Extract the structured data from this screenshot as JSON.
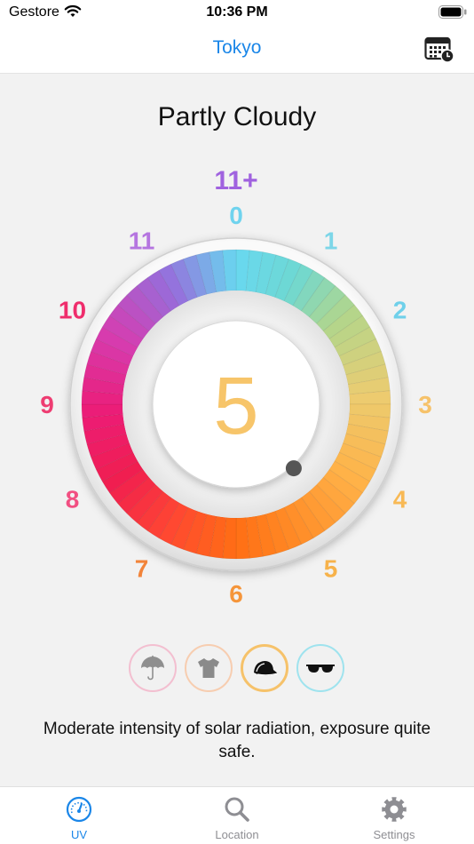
{
  "status_bar": {
    "carrier": "Gestore",
    "time": "10:36 PM"
  },
  "nav": {
    "title": "Tokyo",
    "calendar_icon": "calendar-clock-icon"
  },
  "weather": {
    "condition": "Partly Cloudy"
  },
  "uv": {
    "value": "5",
    "level": 5,
    "scale_labels": [
      "0",
      "1",
      "2",
      "3",
      "4",
      "5",
      "6",
      "7",
      "8",
      "9",
      "10",
      "11",
      "11+"
    ],
    "label_colors": [
      "#6fd3ee",
      "#7dd6e8",
      "#6fd0ea",
      "#f6c26a",
      "#f8b955",
      "#f7b24a",
      "#f5953a",
      "#f2843a",
      "#f24f82",
      "#ee3d72",
      "#ef2d6c",
      "#b575e0",
      "#a062df"
    ],
    "number_color": "#f7c56a"
  },
  "protection_icons": [
    {
      "icon": "umbrella-icon",
      "color": "#f3bfd0"
    },
    {
      "icon": "tshirt-icon",
      "color": "#f7cdb0"
    },
    {
      "icon": "cap-icon",
      "color": "#f6c26a"
    },
    {
      "icon": "sunglasses-icon",
      "color": "#9fe3ee"
    }
  ],
  "description": "Moderate intensity of solar radiation, exposure quite safe.",
  "tabs": [
    {
      "label": "UV",
      "icon": "gauge-icon",
      "active": true
    },
    {
      "label": "Location",
      "icon": "search-icon",
      "active": false
    },
    {
      "label": "Settings",
      "icon": "gear-icon",
      "active": false
    }
  ],
  "colors": {
    "accent": "#1a86e8",
    "inactive_tab": "#8e8e93"
  }
}
